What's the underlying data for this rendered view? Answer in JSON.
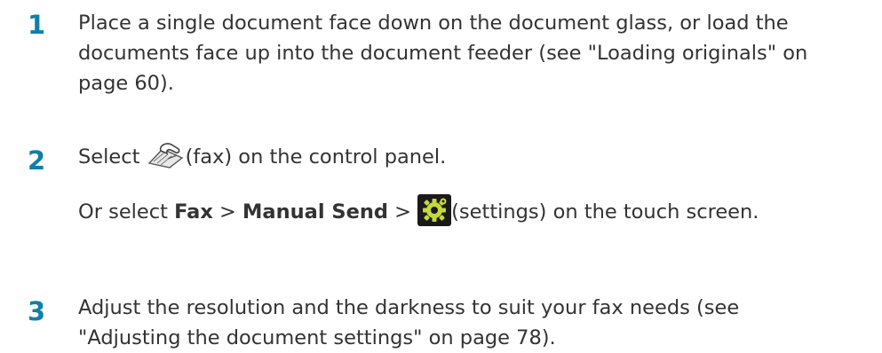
{
  "steps": [
    {
      "number": "1",
      "lines": [
        "Place a single document face down on the document glass, or load the",
        "documents face up into the document feeder (see \"Loading originals\" on",
        "page 60)."
      ]
    },
    {
      "number": "2",
      "select_prefix": "Select ",
      "fax_icon": "fax-icon",
      "select_suffix": "(fax) on the control panel.",
      "or_select": "Or select ",
      "fax_label": "Fax",
      "sep1": " > ",
      "manual_send_label": "Manual Send",
      "sep2": " > ",
      "settings_icon": "gear-icon",
      "settings_suffix": "(settings) on the touch screen."
    },
    {
      "number": "3",
      "lines": [
        "Adjust the resolution and the darkness to suit your fax needs (see",
        "\"Adjusting the document settings\" on page 78)."
      ]
    }
  ],
  "colors": {
    "step_number": "#0f7fa8",
    "body_text": "#333333"
  }
}
